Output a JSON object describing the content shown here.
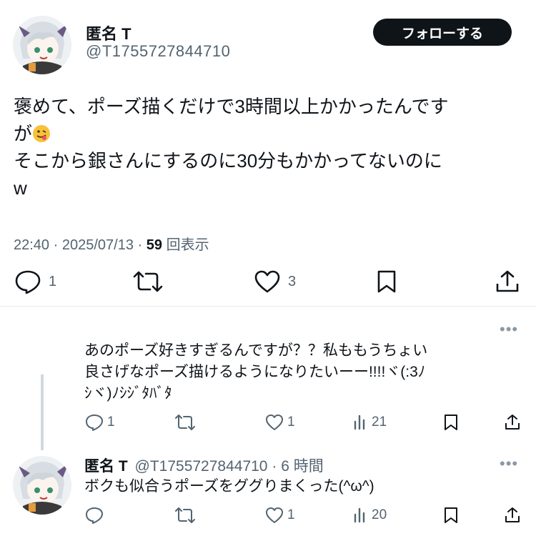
{
  "tweet": {
    "author_name": "匿名 T",
    "author_handle": "@T1755727844710",
    "follow_label": "フォローする",
    "text_line1": "褒めて、ポーズ描くだけで3時間以上かかったんです",
    "text_line2": "が",
    "text_line3": "そこから銀さんにするのに30分もかかってないのに",
    "text_line4": "w",
    "emoji": "face-with-tongue-emoji",
    "time": "22:40",
    "date": "2025/07/13",
    "views": "59",
    "views_label": "回表示",
    "separator": "·",
    "replies": "1",
    "likes": "3"
  },
  "reply1": {
    "text_line1": "あのポーズ好きすぎるんですが？？私ももうちょい",
    "text_line2": "良さげなポーズ描けるようになりたいーー!!!!ヾ(:3ﾉ",
    "text_line3": "ｼヾ)ﾉｼｼﾞﾀﾊﾞﾀ",
    "replies": "1",
    "likes": "1",
    "views": "21",
    "more": "•••"
  },
  "reply2": {
    "author_name": "匿名 T",
    "author_handle": "@T1755727844710",
    "time_ago": "6 時間",
    "separator": "·",
    "text": "ボクも似合うポーズをググりまくった(^ω^)",
    "likes": "1",
    "views": "20",
    "more": "•••"
  },
  "colors": {
    "text": "#0f1419",
    "secondary": "#536471",
    "button_bg": "#0f1419",
    "divider": "#e6e9eb"
  },
  "icons": [
    "reply-icon",
    "retweet-icon",
    "like-icon",
    "bookmark-icon",
    "share-icon",
    "views-icon",
    "more-icon"
  ]
}
